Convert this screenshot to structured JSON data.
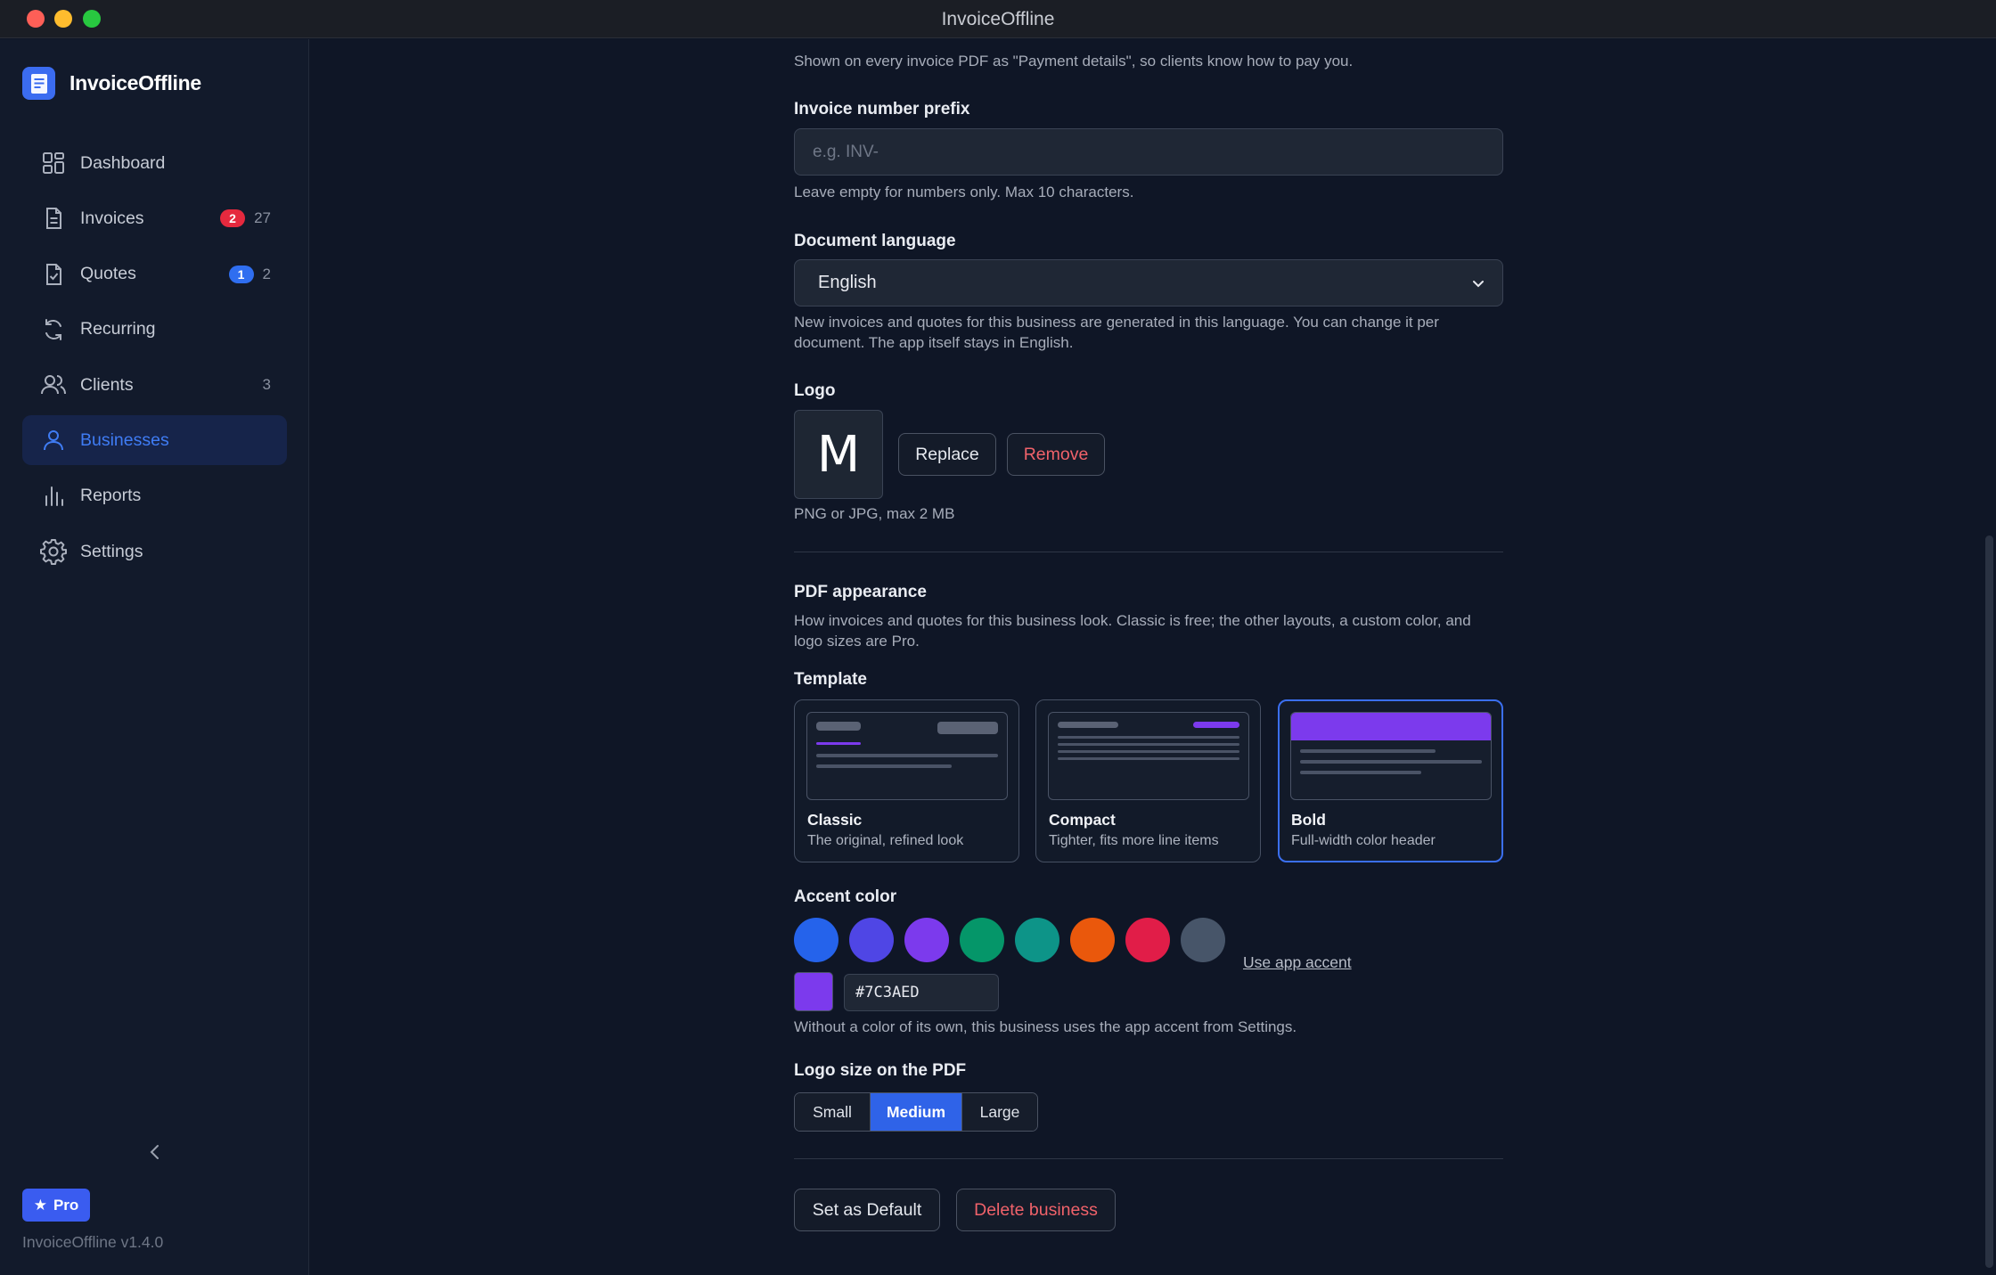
{
  "window": {
    "title": "InvoiceOffline"
  },
  "app": {
    "name": "InvoiceOffline",
    "version": "InvoiceOffline v1.4.0",
    "pro_label": "Pro"
  },
  "sidebar": {
    "items": [
      {
        "label": "Dashboard",
        "icon": "dashboard-icon"
      },
      {
        "label": "Invoices",
        "icon": "invoice-icon",
        "badge": "2",
        "count": "27"
      },
      {
        "label": "Quotes",
        "icon": "quote-icon",
        "badge": "1",
        "count": "2"
      },
      {
        "label": "Recurring",
        "icon": "recurring-icon"
      },
      {
        "label": "Clients",
        "icon": "clients-icon",
        "count": "3"
      },
      {
        "label": "Businesses",
        "icon": "business-icon",
        "active": true
      },
      {
        "label": "Reports",
        "icon": "reports-icon"
      },
      {
        "label": "Settings",
        "icon": "settings-icon"
      }
    ]
  },
  "form": {
    "payment_help": "Shown on every invoice PDF as \"Payment details\", so clients know how to pay you.",
    "prefix": {
      "label": "Invoice number prefix",
      "placeholder": "e.g. INV-",
      "help": "Leave empty for numbers only. Max 10 characters."
    },
    "language": {
      "label": "Document language",
      "value": "English",
      "help": "New invoices and quotes for this business are generated in this language. You can change it per document. The app itself stays in English."
    },
    "logo": {
      "label": "Logo",
      "letter": "M",
      "replace_label": "Replace",
      "remove_label": "Remove",
      "help": "PNG or JPG, max 2 MB"
    },
    "pdf": {
      "heading": "PDF appearance",
      "help": "How invoices and quotes for this business look. Classic is free; the other layouts, a custom color, and logo sizes are Pro.",
      "template_label": "Template",
      "templates": [
        {
          "name": "Classic",
          "desc": "The original, refined look"
        },
        {
          "name": "Compact",
          "desc": "Tighter, fits more line items"
        },
        {
          "name": "Bold",
          "desc": "Full-width color header",
          "selected": true
        }
      ],
      "accent": {
        "label": "Accent color",
        "swatches": [
          "#2563eb",
          "#4f46e5",
          "#7c3aed",
          "#059669",
          "#0d9488",
          "#ea580c",
          "#e11d48",
          "#475569"
        ],
        "use_app_accent": "Use app accent",
        "hex": "#7C3AED",
        "help": "Without a color of its own, this business uses the app accent from Settings."
      },
      "logo_size": {
        "label": "Logo size on the PDF",
        "options": [
          "Small",
          "Medium",
          "Large"
        ],
        "selected": "Medium"
      }
    },
    "actions": {
      "default_label": "Set as Default",
      "delete_label": "Delete business"
    }
  }
}
